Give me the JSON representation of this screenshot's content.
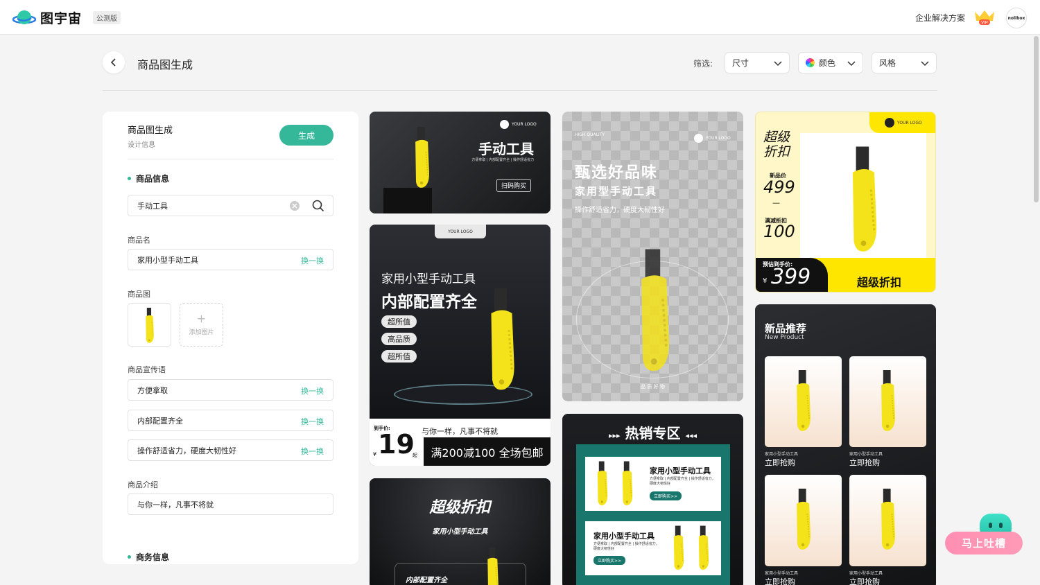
{
  "header": {
    "logo_text": "图宇宙",
    "beta_tag": "公测版",
    "enterprise_link": "企业解决方案",
    "vip_label": "VIP",
    "avatar_text": "nolibox"
  },
  "page": {
    "title": "商品图生成",
    "filter_label": "筛选:",
    "filters": [
      {
        "label": "尺寸"
      },
      {
        "label": "颜色"
      },
      {
        "label": "风格"
      }
    ]
  },
  "panel": {
    "title": "商品图生成",
    "subtitle": "设计信息",
    "generate_label": "生成",
    "product_info_heading": "商品信息",
    "search_value": "手动工具",
    "name_label": "商品名",
    "name_value": "家用小型手动工具",
    "swap_label": "换一换",
    "image_label": "商品图",
    "add_image_label": "添加图片",
    "slogan_label": "商品宣传语",
    "slogans": [
      "方便拿取",
      "内部配置齐全",
      "操作舒适省力，硬度大韧性好"
    ],
    "intro_label": "商品介绍",
    "intro_value": "与你一样，凡事不将就",
    "business_heading": "商务信息"
  },
  "cards": {
    "c1": {
      "title": "手动工具",
      "sub": "方便拿取 | 内部配置齐全 | 操作舒适省力",
      "btn": "扫码购买",
      "logo": "YOUR LOGO"
    },
    "c2": {
      "logo": "YOUR LOGO",
      "line1": "家用小型手动工具",
      "line2": "内部配置齐全",
      "pills": [
        "超所值",
        "高品质",
        "超所值"
      ],
      "price_label": "到手价:",
      "currency": "¥",
      "price": "19",
      "price_suffix": "起",
      "slogan": "与你一样，凡事不将就",
      "promo": "满200减100 全场包邮"
    },
    "c3": {
      "title": "超级折扣",
      "sub": "家用小型手动工具",
      "tag": "内部配置齐全"
    },
    "c4": {
      "quality": "HIGH QUALITY",
      "logo": "YOUR LOGO",
      "title": "甄选好品味",
      "sub": "家用型手动工具",
      "desc": "操作舒适省力，硬度大韧性好",
      "foot": "品 质 好 物"
    },
    "c5": {
      "title": "热销专区",
      "item_title": "家用小型手动工具",
      "item_desc": "方便拿取 | 内部配置齐全 | 操作舒适省力，硬度大韧性好",
      "btn": "立即购买>>"
    },
    "c6": {
      "logo": "YOUR LOGO",
      "headline": "超级折扣",
      "new_price_label": "新品价",
      "new_price": "499",
      "dash": "—",
      "discount_label": "满减折扣",
      "discount": "100",
      "final_label": "预估到手价:",
      "currency": "¥",
      "final_price": "399",
      "banner": "超级折扣"
    },
    "c7": {
      "title": "新品推荐",
      "sub": "New Product",
      "item_name": "家用小型手动工具",
      "item_btn": "立即抢购"
    }
  },
  "feedback": {
    "label": "马上吐槽"
  },
  "colors": {
    "accent": "#35b89a",
    "dark_card": "#1f2023",
    "yellow": "#ffe600"
  }
}
